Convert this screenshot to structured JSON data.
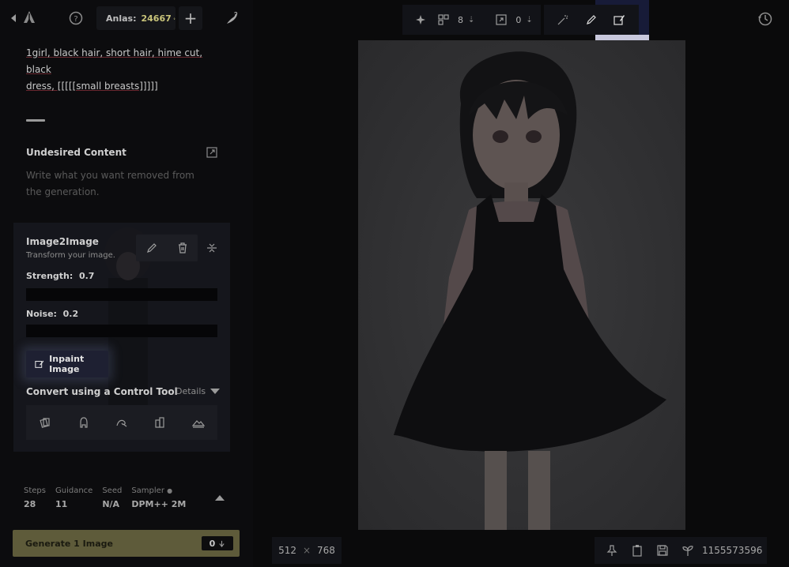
{
  "topbar": {
    "anlas_label": "Anlas:",
    "anlas_value": "24667",
    "plus": "+"
  },
  "prompt": {
    "text_1": "1girl, black hair, short hair, hime cut, black",
    "text_2": "dress, [[[[[small breasts]]]]]"
  },
  "undesired": {
    "title": "Undesired Content",
    "placeholder": "Write what you want removed from the generation."
  },
  "img2img": {
    "title": "Image2Image",
    "subtitle": "Transform your image.",
    "strength_label": "Strength:",
    "strength_value": "0.7",
    "noise_label": "Noise:",
    "noise_value": "0.2",
    "inpaint_label": "Inpaint Image",
    "convert_title": "Convert using a Control Tool",
    "details_label": "Details"
  },
  "params": {
    "steps_label": "Steps",
    "steps_value": "28",
    "guidance_label": "Guidance",
    "guidance_value": "11",
    "seed_label": "Seed",
    "seed_value": "N/A",
    "sampler_label": "Sampler",
    "sampler_value": "DPM++ 2M"
  },
  "generate": {
    "label": "Generate 1 Image",
    "cost": "0"
  },
  "toolbar": {
    "variations_count": "8",
    "upscale_count": "0"
  },
  "canvas": {
    "width": "512",
    "height": "768",
    "times": "×"
  },
  "seed_display": "1155573596",
  "colors": {
    "accent_anlas": "#c9c47a",
    "generate_button": "#5e5b3a",
    "inpaint_button": "#1e2032"
  }
}
